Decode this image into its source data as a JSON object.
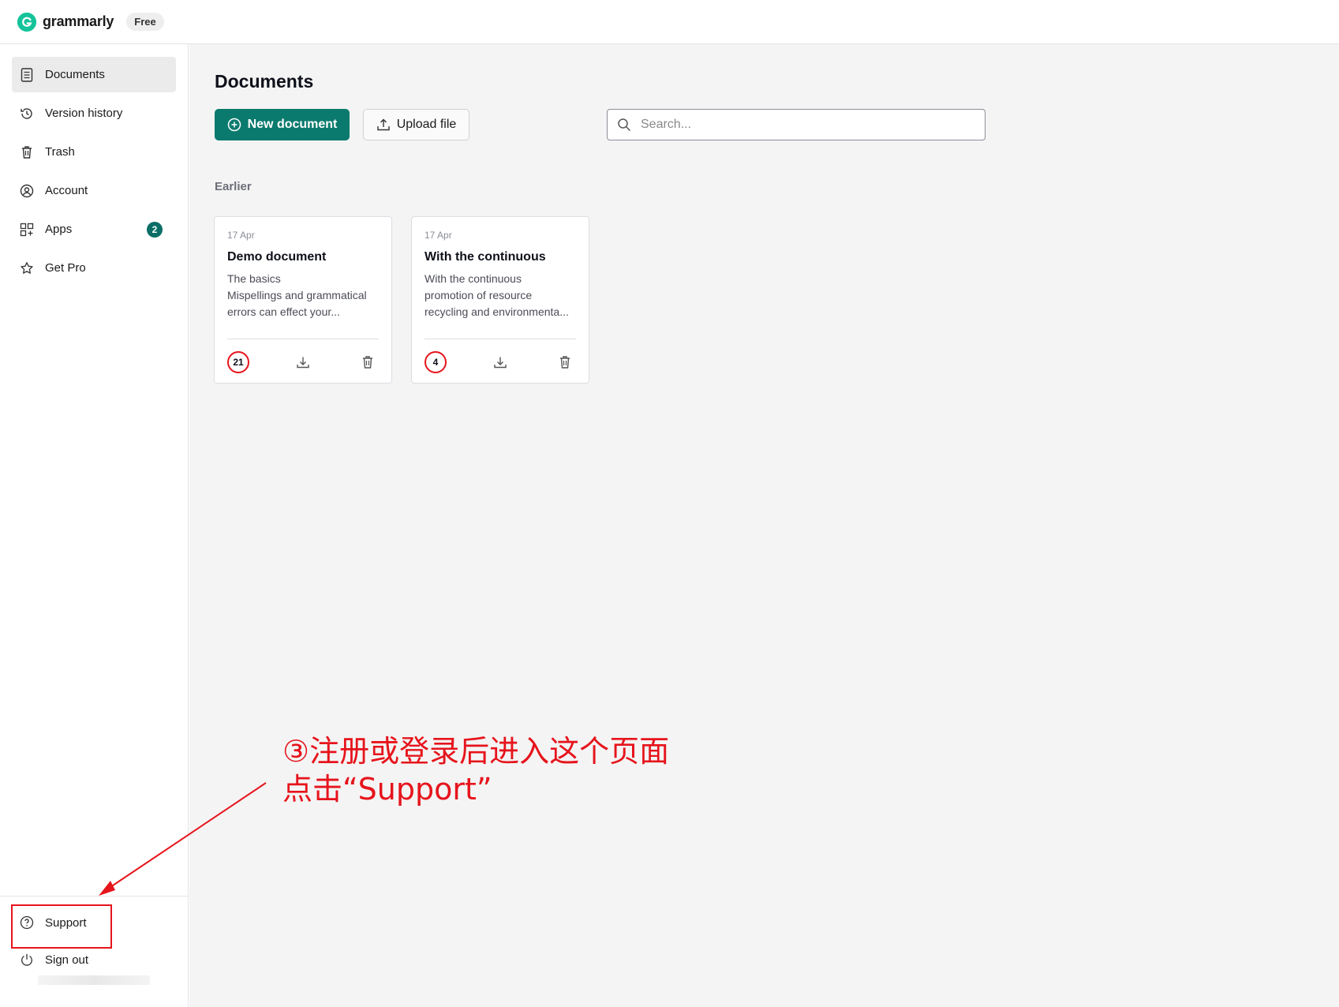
{
  "app": {
    "logo_text": "grammarly",
    "plan_badge": "Free",
    "brand_color": "#15c39a",
    "accent_color": "#0b7a6e"
  },
  "sidebar": {
    "items": [
      {
        "label": "Documents",
        "icon": "document-icon",
        "active": true
      },
      {
        "label": "Version history",
        "icon": "history-icon"
      },
      {
        "label": "Trash",
        "icon": "trash-icon"
      },
      {
        "label": "Account",
        "icon": "account-icon"
      },
      {
        "label": "Apps",
        "icon": "apps-icon",
        "badge": "2"
      },
      {
        "label": "Get Pro",
        "icon": "star-icon"
      }
    ],
    "bottom": [
      {
        "label": "Support",
        "icon": "help-icon"
      },
      {
        "label": "Sign out",
        "icon": "power-icon"
      }
    ]
  },
  "main": {
    "title": "Documents",
    "new_button": "New document",
    "upload_button": "Upload file",
    "search_placeholder": "Search...",
    "section_label": "Earlier",
    "documents": [
      {
        "date": "17 Apr",
        "title": "Demo document",
        "snippet": [
          "The basics",
          "Mispellings and grammatical",
          "errors can effect your..."
        ],
        "score": "21"
      },
      {
        "date": "17 Apr",
        "title": "With the continuous",
        "snippet": [
          "With the continuous",
          "promotion of resource",
          "recycling and environmenta..."
        ],
        "score": "4"
      }
    ]
  },
  "annotation": {
    "line1": "③注册或登录后进入这个页面",
    "line2": "点击“Support”",
    "color": "#e6141c"
  }
}
